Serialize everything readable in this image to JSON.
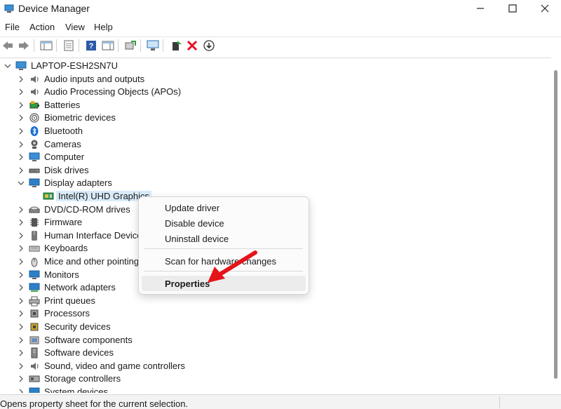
{
  "window": {
    "title": "Device Manager"
  },
  "menu": [
    {
      "id": "file",
      "label": "File"
    },
    {
      "id": "action",
      "label": "Action"
    },
    {
      "id": "view",
      "label": "View"
    },
    {
      "id": "help",
      "label": "Help"
    }
  ],
  "toolbar": {
    "icons": [
      "back-arrow-icon",
      "forward-arrow-icon",
      "show-hide-tree-icon",
      "properties-sheet-icon",
      "help-icon",
      "action-pane-icon",
      "update-driver-icon",
      "scan-hardware-icon",
      "enable-device-icon",
      "uninstall-device-icon",
      "download-driver-icon"
    ]
  },
  "tree": {
    "root": "LAPTOP-ESH2SN7U",
    "categories": [
      {
        "label": "Audio inputs and outputs",
        "icon": "speaker-icon"
      },
      {
        "label": "Audio Processing Objects (APOs)",
        "icon": "speaker-icon"
      },
      {
        "label": "Batteries",
        "icon": "battery-icon"
      },
      {
        "label": "Biometric devices",
        "icon": "fingerprint-icon"
      },
      {
        "label": "Bluetooth",
        "icon": "bluetooth-icon"
      },
      {
        "label": "Cameras",
        "icon": "camera-icon"
      },
      {
        "label": "Computer",
        "icon": "computer-icon"
      },
      {
        "label": "Disk drives",
        "icon": "disk-drive-icon"
      },
      {
        "label": "Display adapters",
        "icon": "monitor-icon",
        "expanded": true,
        "children": [
          "Intel(R) UHD Graphics"
        ]
      },
      {
        "label": "DVD/CD-ROM drives",
        "icon": "dvd-drive-icon"
      },
      {
        "label": "Firmware",
        "icon": "firmware-chip-icon"
      },
      {
        "label": "Human Interface Devices",
        "icon": "hid-icon"
      },
      {
        "label": "Keyboards",
        "icon": "keyboard-icon"
      },
      {
        "label": "Mice and other pointing devices",
        "icon": "mouse-icon"
      },
      {
        "label": "Monitors",
        "icon": "monitor-icon"
      },
      {
        "label": "Network adapters",
        "icon": "network-adapter-icon"
      },
      {
        "label": "Print queues",
        "icon": "printer-icon"
      },
      {
        "label": "Processors",
        "icon": "processor-chip-icon"
      },
      {
        "label": "Security devices",
        "icon": "security-chip-icon"
      },
      {
        "label": "Software components",
        "icon": "software-component-icon"
      },
      {
        "label": "Software devices",
        "icon": "software-device-icon"
      },
      {
        "label": "Sound, video and game controllers",
        "icon": "speaker-icon"
      },
      {
        "label": "Storage controllers",
        "icon": "storage-controller-icon"
      },
      {
        "label": "System devices",
        "icon": "system-devices-icon"
      }
    ]
  },
  "context_menu": {
    "items": [
      {
        "label": "Update driver"
      },
      {
        "label": "Disable device"
      },
      {
        "label": "Uninstall device"
      },
      {
        "label": "Scan for hardware changes"
      },
      {
        "label": "Properties",
        "bold": true,
        "highlighted": true
      }
    ]
  },
  "status": {
    "text": "Opens property sheet for the current selection."
  },
  "colors": {
    "selection": "#d9ebf9",
    "annotation_arrow": "#e5141b",
    "delete_icon": "#e81123"
  }
}
